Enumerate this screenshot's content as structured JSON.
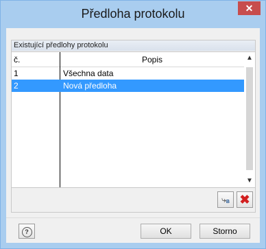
{
  "window": {
    "title": "Předloha protokolu",
    "close_glyph": "✕"
  },
  "group": {
    "title": "Existující předlohy protokolu"
  },
  "table": {
    "columns": {
      "no": "č.",
      "desc": "Popis"
    },
    "rows": [
      {
        "no": "1",
        "desc": "Všechna data",
        "selected": false
      },
      {
        "no": "2",
        "desc": "Nová předloha",
        "selected": true
      }
    ]
  },
  "icons": {
    "scroll_up": "up-arrow-icon",
    "scroll_down": "down-arrow-icon",
    "import": "import-template-icon",
    "delete": "delete-x-icon",
    "help": "help-icon"
  },
  "toolbar": {
    "import_glyph": "⤷",
    "import_badge": "B",
    "delete_glyph": "✖"
  },
  "buttons": {
    "ok": "OK",
    "cancel": "Storno",
    "help_glyph": "?"
  },
  "colors": {
    "selection": "#3399ff",
    "title_bar": "#a9cdef",
    "close": "#c74d4d"
  }
}
